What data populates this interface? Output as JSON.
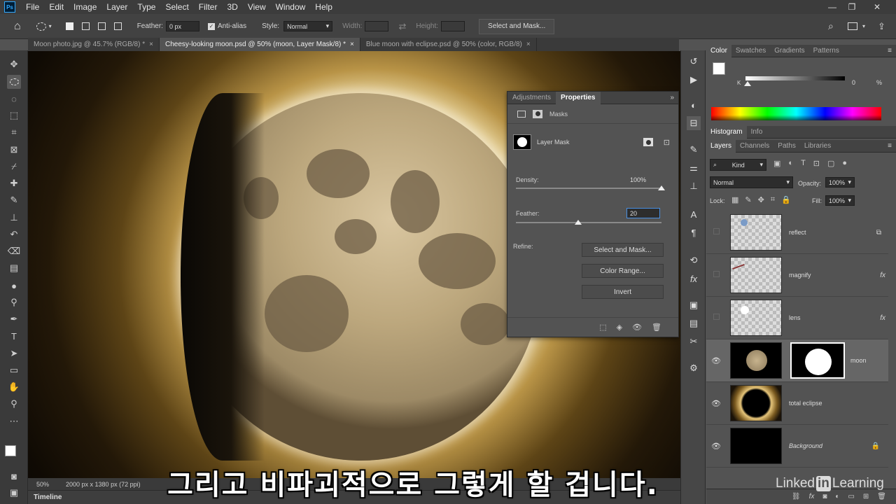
{
  "app": {
    "logo": "Ps"
  },
  "menu": [
    "File",
    "Edit",
    "Image",
    "Layer",
    "Type",
    "Select",
    "Filter",
    "3D",
    "View",
    "Window",
    "Help"
  ],
  "window_controls": {
    "minimize": "—",
    "restore": "❐",
    "close": "✕"
  },
  "options": {
    "feather_label": "Feather:",
    "feather_value": "0 px",
    "antialias_label": "Anti-alias",
    "style_label": "Style:",
    "style_value": "Normal",
    "width_label": "Width:",
    "height_label": "Height:",
    "select_mask_label": "Select and Mask..."
  },
  "tabs": [
    {
      "label": "Moon photo.jpg @ 45.7% (RGB/8) *",
      "close": "×"
    },
    {
      "label": "Cheesy-looking moon.psd @ 50% (moon, Layer Mask/8) *",
      "close": "×"
    },
    {
      "label": "Blue moon with eclipse.psd @ 50% (color, RGB/8)",
      "close": "×"
    }
  ],
  "status": {
    "zoom": "50%",
    "doc": "2000 px x 1380 px (72 ppi)"
  },
  "timeline_label": "Timeline",
  "properties": {
    "tab_adjustments": "Adjustments",
    "tab_properties": "Properties",
    "masks_label": "Masks",
    "layer_mask_label": "Layer Mask",
    "density_label": "Density:",
    "density_value": "100%",
    "density_fraction": 1.0,
    "feather_label": "Feather:",
    "feather_value": "20",
    "feather_fraction": 0.43,
    "refine_label": "Refine:",
    "btn_select_mask": "Select and Mask...",
    "btn_color_range": "Color Range...",
    "btn_invert": "Invert"
  },
  "color_panel": {
    "tabs": [
      "Color",
      "Swatches",
      "Gradients",
      "Patterns"
    ],
    "k_label": "K",
    "k_value": "0",
    "k_unit": "%"
  },
  "histogram_tabs": [
    "Histogram",
    "Info"
  ],
  "layers_panel": {
    "tabs": [
      "Layers",
      "Channels",
      "Paths",
      "Libraries"
    ],
    "kind_label": "Kind",
    "blend_mode": "Normal",
    "opacity_label": "Opacity:",
    "opacity_value": "100%",
    "lock_label": "Lock:",
    "fill_label": "Fill:",
    "fill_value": "100%",
    "fx": "fx",
    "layers": [
      {
        "name": "reflect",
        "visible": false
      },
      {
        "name": "magnify",
        "visible": false
      },
      {
        "name": "lens",
        "visible": false
      },
      {
        "name": "moon",
        "visible": true
      },
      {
        "name": "total eclipse",
        "visible": true
      },
      {
        "name": "Background",
        "visible": true
      }
    ]
  },
  "caption": "그리고 비파괴적으로 그렇게 할 겁니다.",
  "watermark": {
    "pre": "Linked",
    "in": "in",
    "post": "Learning"
  },
  "colors": {
    "accent": "#31a8ff",
    "panel": "#535353",
    "dark": "#3a3a3a"
  }
}
